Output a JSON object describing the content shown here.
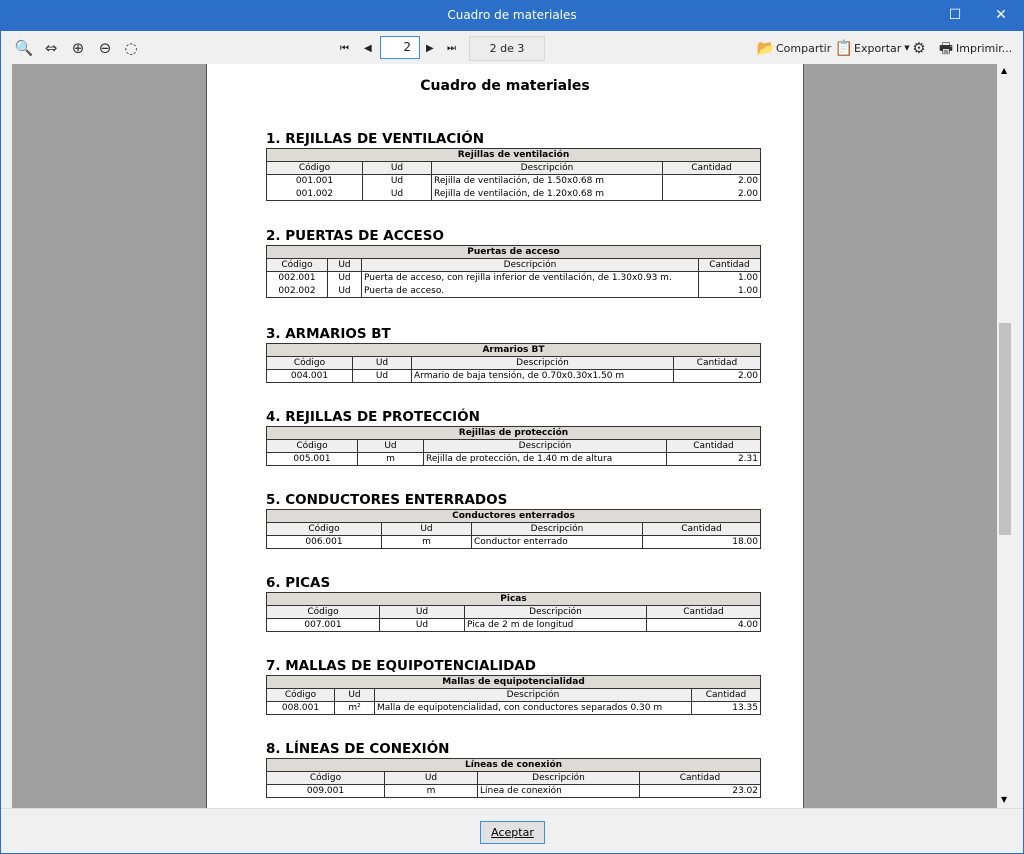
{
  "window": {
    "title": "Cuadro de materiales"
  },
  "toolbar": {
    "page_value": "2",
    "page_count": "2 de 3",
    "share": "Compartir",
    "export": "Exportar",
    "print": "Imprimir..."
  },
  "document": {
    "title": "Cuadro de materiales",
    "sections": [
      {
        "heading": "1. REJILLAS DE VENTILACIÓN",
        "table_title": "Rejillas  de  ventilación",
        "columns": [
          "Código",
          "Ud",
          "Descripción",
          "Cantidad"
        ],
        "rows": [
          [
            "001.001",
            "Ud",
            "Rejilla de ventilación, de 1.50x0.68 m",
            "2.00"
          ],
          [
            "001.002",
            "Ud",
            "Rejilla de ventilación, de 1.20x0.68 m",
            "2.00"
          ]
        ]
      },
      {
        "heading": "2. PUERTAS DE ACCESO",
        "table_title": "Puertas de acceso",
        "columns": [
          "Código",
          "Ud",
          "Descripción",
          "Cantidad"
        ],
        "rows": [
          [
            "002.001",
            "Ud",
            "Puerta de acceso, con rejilla inferior de ventilación, de 1.30x0.93 m.",
            "1.00"
          ],
          [
            "002.002",
            "Ud",
            "Puerta de acceso.",
            "1.00"
          ]
        ]
      },
      {
        "heading": "3. ARMARIOS BT",
        "table_title": "Armarios BT",
        "columns": [
          "Código",
          "Ud",
          "Descripción",
          "Cantidad"
        ],
        "rows": [
          [
            "004.001",
            "Ud",
            "Armario de baja tensión, de 0.70x0.30x1.50 m",
            "2.00"
          ]
        ]
      },
      {
        "heading": "4. REJILLAS DE PROTECCIÓN",
        "table_title": "Rejillas  de  protección",
        "columns": [
          "Código",
          "Ud",
          "Descripción",
          "Cantidad"
        ],
        "rows": [
          [
            "005.001",
            "m",
            "Rejilla de protección, de 1.40 m de altura",
            "2.31"
          ]
        ]
      },
      {
        "heading": "5. CONDUCTORES ENTERRADOS",
        "table_title": "Conductores  enterrados",
        "columns": [
          "Código",
          "Ud",
          "Descripción",
          "Cantidad"
        ],
        "rows": [
          [
            "006.001",
            "m",
            "Conductor enterrado",
            "18.00"
          ]
        ]
      },
      {
        "heading": "6. PICAS",
        "table_title": "Picas",
        "columns": [
          "Código",
          "Ud",
          "Descripción",
          "Cantidad"
        ],
        "rows": [
          [
            "007.001",
            "Ud",
            "Pica de 2 m de longitud",
            "4.00"
          ]
        ]
      },
      {
        "heading": "7. MALLAS DE EQUIPOTENCIALIDAD",
        "table_title": "Mallas  de  equipotencialidad",
        "columns": [
          "Código",
          "Ud",
          "Descripción",
          "Cantidad"
        ],
        "rows": [
          [
            "008.001",
            "m²",
            "Malla de equipotencialidad, con conductores separados 0.30 m",
            "13.35"
          ]
        ]
      },
      {
        "heading": "8. LÍNEAS DE CONEXIÓN",
        "table_title": "Líneas de conexión",
        "columns": [
          "Código",
          "Ud",
          "Descripción",
          "Cantidad"
        ],
        "rows": [
          [
            "009.001",
            "m",
            "Línea de conexión",
            "23.02"
          ]
        ]
      }
    ]
  },
  "footer": {
    "accept": "Aceptar"
  }
}
